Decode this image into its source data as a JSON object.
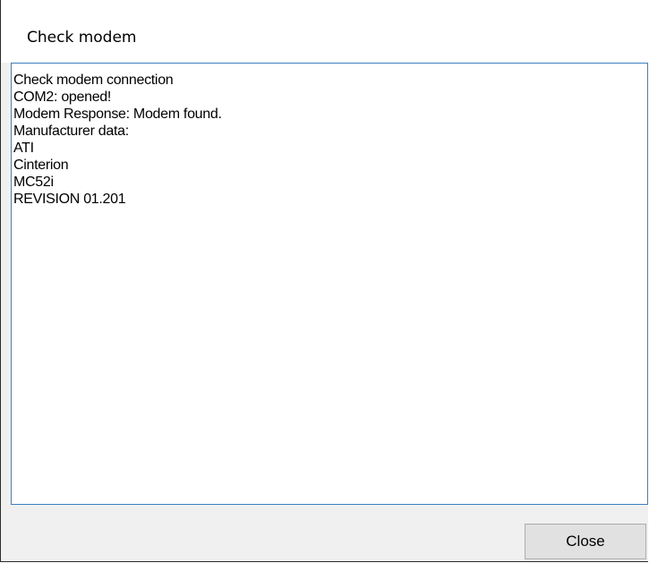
{
  "window": {
    "title": "Check modem"
  },
  "log": {
    "lines": [
      "Check modem connection",
      "COM2: opened!",
      "Modem Response: Modem found.",
      "Manufacturer data:",
      "ATI",
      "Cinterion",
      "MC52i",
      "REVISION 01.201"
    ]
  },
  "buttons": {
    "close_label": "Close"
  },
  "colors": {
    "log_border": "#3c7fc4",
    "dialog_background": "#f0f0f0",
    "button_background": "#e1e1e1"
  }
}
